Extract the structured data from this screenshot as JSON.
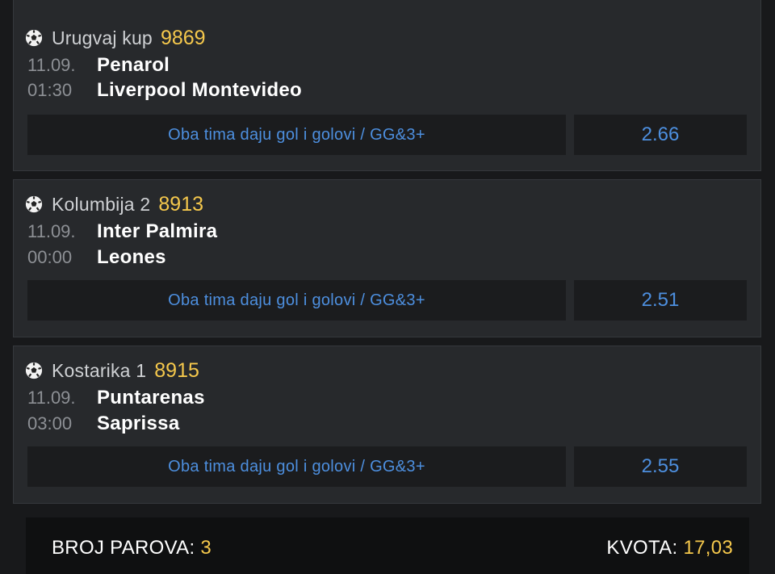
{
  "matches": [
    {
      "league": "Urugvaj kup",
      "code": "9869",
      "date": "11.09.",
      "time": "01:30",
      "home": "Penarol",
      "away": "Liverpool Montevideo",
      "bet": "Oba tima daju gol i golovi / GG&3+",
      "odd": "2.66",
      "sport_icon": "soccer-ball-icon"
    },
    {
      "league": "Kolumbija 2",
      "code": "8913",
      "date": "11.09.",
      "time": "00:00",
      "home": "Inter Palmira",
      "away": "Leones",
      "bet": "Oba tima daju gol i golovi / GG&3+",
      "odd": "2.51",
      "sport_icon": "soccer-ball-icon"
    },
    {
      "league": "Kostarika 1",
      "code": "8915",
      "date": "11.09.",
      "time": "03:00",
      "home": "Puntarenas",
      "away": "Saprissa",
      "bet": "Oba tima daju gol i golovi / GG&3+",
      "odd": "2.55",
      "sport_icon": "soccer-ball-icon"
    }
  ],
  "summary": {
    "pairs_label": "BROJ PAROVA:",
    "pairs_value": "3",
    "odds_label": "KVOTA:",
    "odds_value": "17,03"
  },
  "colors": {
    "accent": "#f5c84c",
    "link": "#4d8fdf",
    "card_bg": "#27292c",
    "page_bg": "#18191b"
  }
}
